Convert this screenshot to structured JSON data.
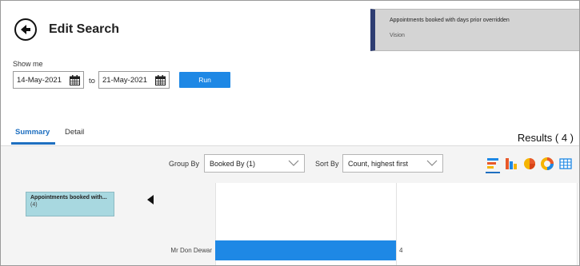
{
  "header": {
    "title": "Edit Search",
    "back_icon": "arrow-left-icon"
  },
  "notification": {
    "title": "Appointments booked with days prior overridden",
    "subtitle": "Vision",
    "accent_color": "#2e3d72"
  },
  "search": {
    "show_me_label": "Show me",
    "from_date": "14-May-2021",
    "to_label": "to",
    "to_date": "21-May-2021",
    "run_label": "Run",
    "calendar_icon": "calendar-icon"
  },
  "tabs": [
    {
      "label": "Summary",
      "active": true
    },
    {
      "label": "Detail",
      "active": false
    }
  ],
  "results_label": "Results ( 4 )",
  "toolbar": {
    "group_by_label": "Group By",
    "group_by_value": "Booked By (1)",
    "sort_by_label": "Sort By",
    "sort_by_value": "Count, highest first",
    "view_icons": [
      "horizontal-bar-chart-icon",
      "vertical-bar-chart-icon",
      "pie-chart-icon",
      "donut-chart-icon",
      "table-icon"
    ],
    "active_view": "horizontal-bar-chart-icon"
  },
  "group_chip": {
    "title": "Appointments booked with...",
    "count": "(4)"
  },
  "chart_data": {
    "type": "bar",
    "orientation": "horizontal",
    "categories": [
      "Mr Don Dewar"
    ],
    "values": [
      4
    ],
    "value_labels": [
      "4"
    ],
    "bar_color": "#1e88e5",
    "grid": true
  }
}
